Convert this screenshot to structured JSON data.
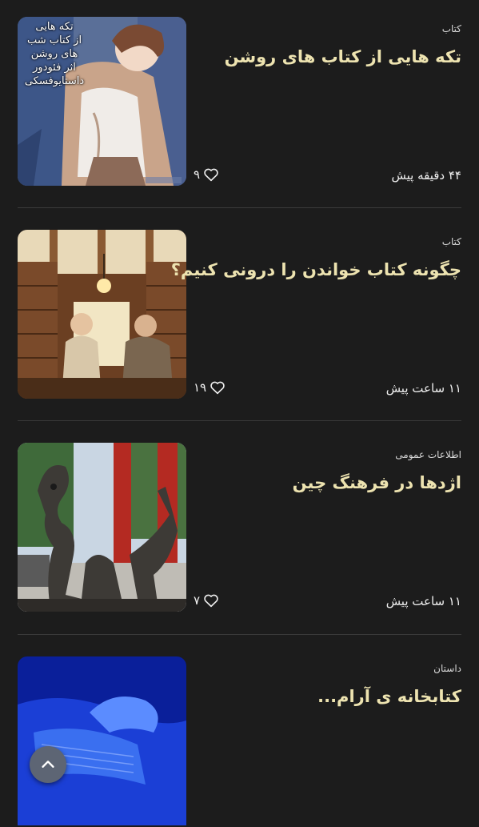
{
  "posts": [
    {
      "category": "کتاب",
      "title": "تکه هایی از کتاب های روشن",
      "time": "۴۴ دقیقه پیش",
      "likes": "۹",
      "image_overlay": [
        "تکه هایی",
        "از کتاب شب",
        "های روشن",
        "اثر فئودور",
        "داستایوفسکی"
      ],
      "image_icon": "anime-character-image"
    },
    {
      "category": "کتاب",
      "title": "چگونه کتاب خواندن را درونی کنیم؟",
      "time": "۱۱ ساعت پیش",
      "likes": "۱۹",
      "image_icon": "library-couple-image"
    },
    {
      "category": "اطلاعات عمومی",
      "title": "اژدها در فرهنگ چین",
      "time": "۱۱ ساعت پیش",
      "likes": "۷",
      "image_icon": "bronze-dragon-statue-image"
    },
    {
      "category": "داستان",
      "title": "کتابخانه ی آرام...",
      "image_icon": "blue-book-hand-image"
    }
  ],
  "icons": {
    "like": "heart-icon",
    "scroll_top": "chevron-up-icon"
  },
  "colors": {
    "background": "#1c1c1c",
    "title": "#ede3b0",
    "divider": "#3a3a3a",
    "scroll_button": "#5d6574"
  }
}
